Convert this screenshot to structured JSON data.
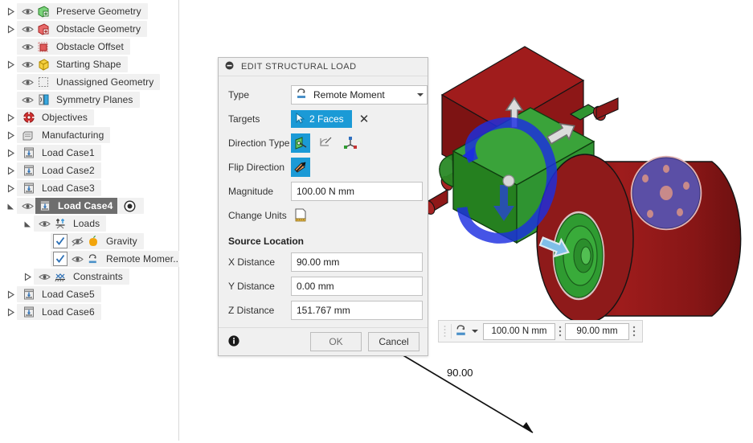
{
  "tree": {
    "name": "model-browser",
    "items": [
      {
        "label": "Preserve Geometry",
        "icon": "preserve-geometry-icon",
        "indent": 0,
        "arrow": true,
        "eye": true,
        "check": false,
        "selected": false
      },
      {
        "label": "Obstacle Geometry",
        "icon": "obstacle-geometry-icon",
        "indent": 0,
        "arrow": true,
        "eye": true,
        "check": false,
        "selected": false
      },
      {
        "label": "Obstacle Offset",
        "icon": "obstacle-offset-icon",
        "indent": 0,
        "arrow": false,
        "eye": true,
        "check": false,
        "selected": false
      },
      {
        "label": "Starting Shape",
        "icon": "starting-shape-icon",
        "indent": 0,
        "arrow": true,
        "eye": true,
        "check": false,
        "selected": false
      },
      {
        "label": "Unassigned Geometry",
        "icon": "unassigned-geometry-icon",
        "indent": 0,
        "arrow": false,
        "eye": true,
        "check": false,
        "selected": false
      },
      {
        "label": "Symmetry Planes",
        "icon": "symmetry-planes-icon",
        "indent": 0,
        "arrow": false,
        "eye": true,
        "check": false,
        "selected": false
      },
      {
        "label": "Objectives",
        "icon": "objectives-icon",
        "indent": 0,
        "arrow": true,
        "eye": false,
        "check": false,
        "selected": false
      },
      {
        "label": "Manufacturing",
        "icon": "manufacturing-icon",
        "indent": 0,
        "arrow": true,
        "eye": false,
        "check": false,
        "selected": false
      },
      {
        "label": "Load Case1",
        "icon": "load-case-icon",
        "indent": 0,
        "arrow": true,
        "eye": false,
        "check": false,
        "selected": false
      },
      {
        "label": "Load Case2",
        "icon": "load-case-icon",
        "indent": 0,
        "arrow": true,
        "eye": false,
        "check": false,
        "selected": false
      },
      {
        "label": "Load Case3",
        "icon": "load-case-icon",
        "indent": 0,
        "arrow": true,
        "eye": false,
        "check": false,
        "selected": false
      },
      {
        "label": "Load Case4",
        "icon": "load-case-icon",
        "indent": 0,
        "arrow": true,
        "eye": true,
        "check": false,
        "selected": true,
        "radio": true
      },
      {
        "label": "Loads",
        "icon": "loads-icon",
        "indent": 1,
        "arrow": true,
        "eye": true,
        "check": false,
        "selected": false
      },
      {
        "label": "Gravity",
        "icon": "gravity-icon",
        "indent": 2,
        "arrow": false,
        "eye": true,
        "eyeOff": true,
        "check": true,
        "selected": false
      },
      {
        "label": "Remote Momer...",
        "icon": "remote-moment-icon",
        "indent": 2,
        "arrow": false,
        "eye": true,
        "check": true,
        "selected": false
      },
      {
        "label": "Constraints",
        "icon": "constraints-icon",
        "indent": 1,
        "arrow": true,
        "eye": true,
        "check": false,
        "selected": false
      },
      {
        "label": "Load Case5",
        "icon": "load-case-icon",
        "indent": 0,
        "arrow": true,
        "eye": false,
        "check": false,
        "selected": false
      },
      {
        "label": "Load Case6",
        "icon": "load-case-icon",
        "indent": 0,
        "arrow": true,
        "eye": false,
        "check": false,
        "selected": false
      }
    ]
  },
  "dialog": {
    "title": "EDIT STRUCTURAL LOAD",
    "collapse_icon": "collapse-icon",
    "rows": {
      "type_label": "Type",
      "type_value": "Remote Moment",
      "targets_label": "Targets",
      "targets_value": "2 Faces",
      "targets_clear": "✕",
      "direction_label": "Direction Type",
      "flip_label": "Flip Direction",
      "magnitude_label": "Magnitude",
      "magnitude_value": "100.00 N mm",
      "change_units_label": "Change Units",
      "source_location": "Source Location",
      "x_label": "X Distance",
      "x_value": "90.00 mm",
      "y_label": "Y Distance",
      "y_value": "0.00 mm",
      "z_label": "Z Distance",
      "z_value": "151.767 mm"
    },
    "footer": {
      "info_icon": "info-icon",
      "ok": "OK",
      "cancel": "Cancel"
    }
  },
  "hud": {
    "type_icon": "remote-moment-icon",
    "magnitude": "100.00 N mm",
    "distance": "90.00 mm",
    "overflow_icon": "more-options-icon"
  },
  "annotation": {
    "dimension_value": "90.00"
  },
  "colors": {
    "accent_blue": "#1b9ad6",
    "model_red": "#9c1c1c",
    "model_green": "#2f9b30",
    "model_purple": "#5b4fa6",
    "moment_blue": "#1c2ee0",
    "selection_gray": "#6e6e6e"
  }
}
